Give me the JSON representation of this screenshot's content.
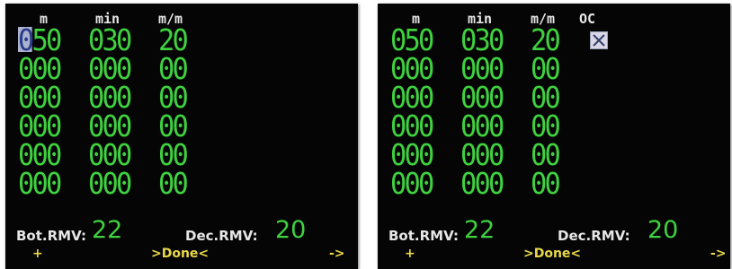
{
  "colors": {
    "background": "#050505",
    "value_green": "#3fd13f",
    "header_white": "#e6e6e6",
    "softkey_yellow": "#e8d84a",
    "cursor_bg": "#a9b3cf"
  },
  "screens": [
    {
      "headers": {
        "m": "m",
        "min": "min",
        "mm": "m/m"
      },
      "cursor": {
        "char": "0",
        "rest": "50"
      },
      "rows": [
        {
          "m": "050",
          "min": "030",
          "mm": "20"
        },
        {
          "m": "000",
          "min": "000",
          "mm": "00"
        },
        {
          "m": "000",
          "min": "000",
          "mm": "00"
        },
        {
          "m": "000",
          "min": "000",
          "mm": "00"
        },
        {
          "m": "000",
          "min": "000",
          "mm": "00"
        },
        {
          "m": "000",
          "min": "000",
          "mm": "00"
        }
      ],
      "bot_rmv": {
        "label": "Bot.RMV:",
        "value": "22"
      },
      "dec_rmv": {
        "label": "Dec.RMV:",
        "value": "20"
      },
      "softkeys": {
        "left": "+",
        "center": ">Done<",
        "right": "->"
      }
    },
    {
      "headers": {
        "m": "m",
        "min": "min",
        "mm": "m/m",
        "oc": "OC"
      },
      "oc_checked": true,
      "rows": [
        {
          "m": "050",
          "min": "030",
          "mm": "20"
        },
        {
          "m": "000",
          "min": "000",
          "mm": "00"
        },
        {
          "m": "000",
          "min": "000",
          "mm": "00"
        },
        {
          "m": "000",
          "min": "000",
          "mm": "00"
        },
        {
          "m": "000",
          "min": "000",
          "mm": "00"
        },
        {
          "m": "000",
          "min": "000",
          "mm": "00"
        }
      ],
      "bot_rmv": {
        "label": "Bot.RMV:",
        "value": "22"
      },
      "dec_rmv": {
        "label": "Dec.RMV:",
        "value": "20"
      },
      "softkeys": {
        "left": "+",
        "center": ">Done<",
        "right": "->"
      }
    }
  ]
}
